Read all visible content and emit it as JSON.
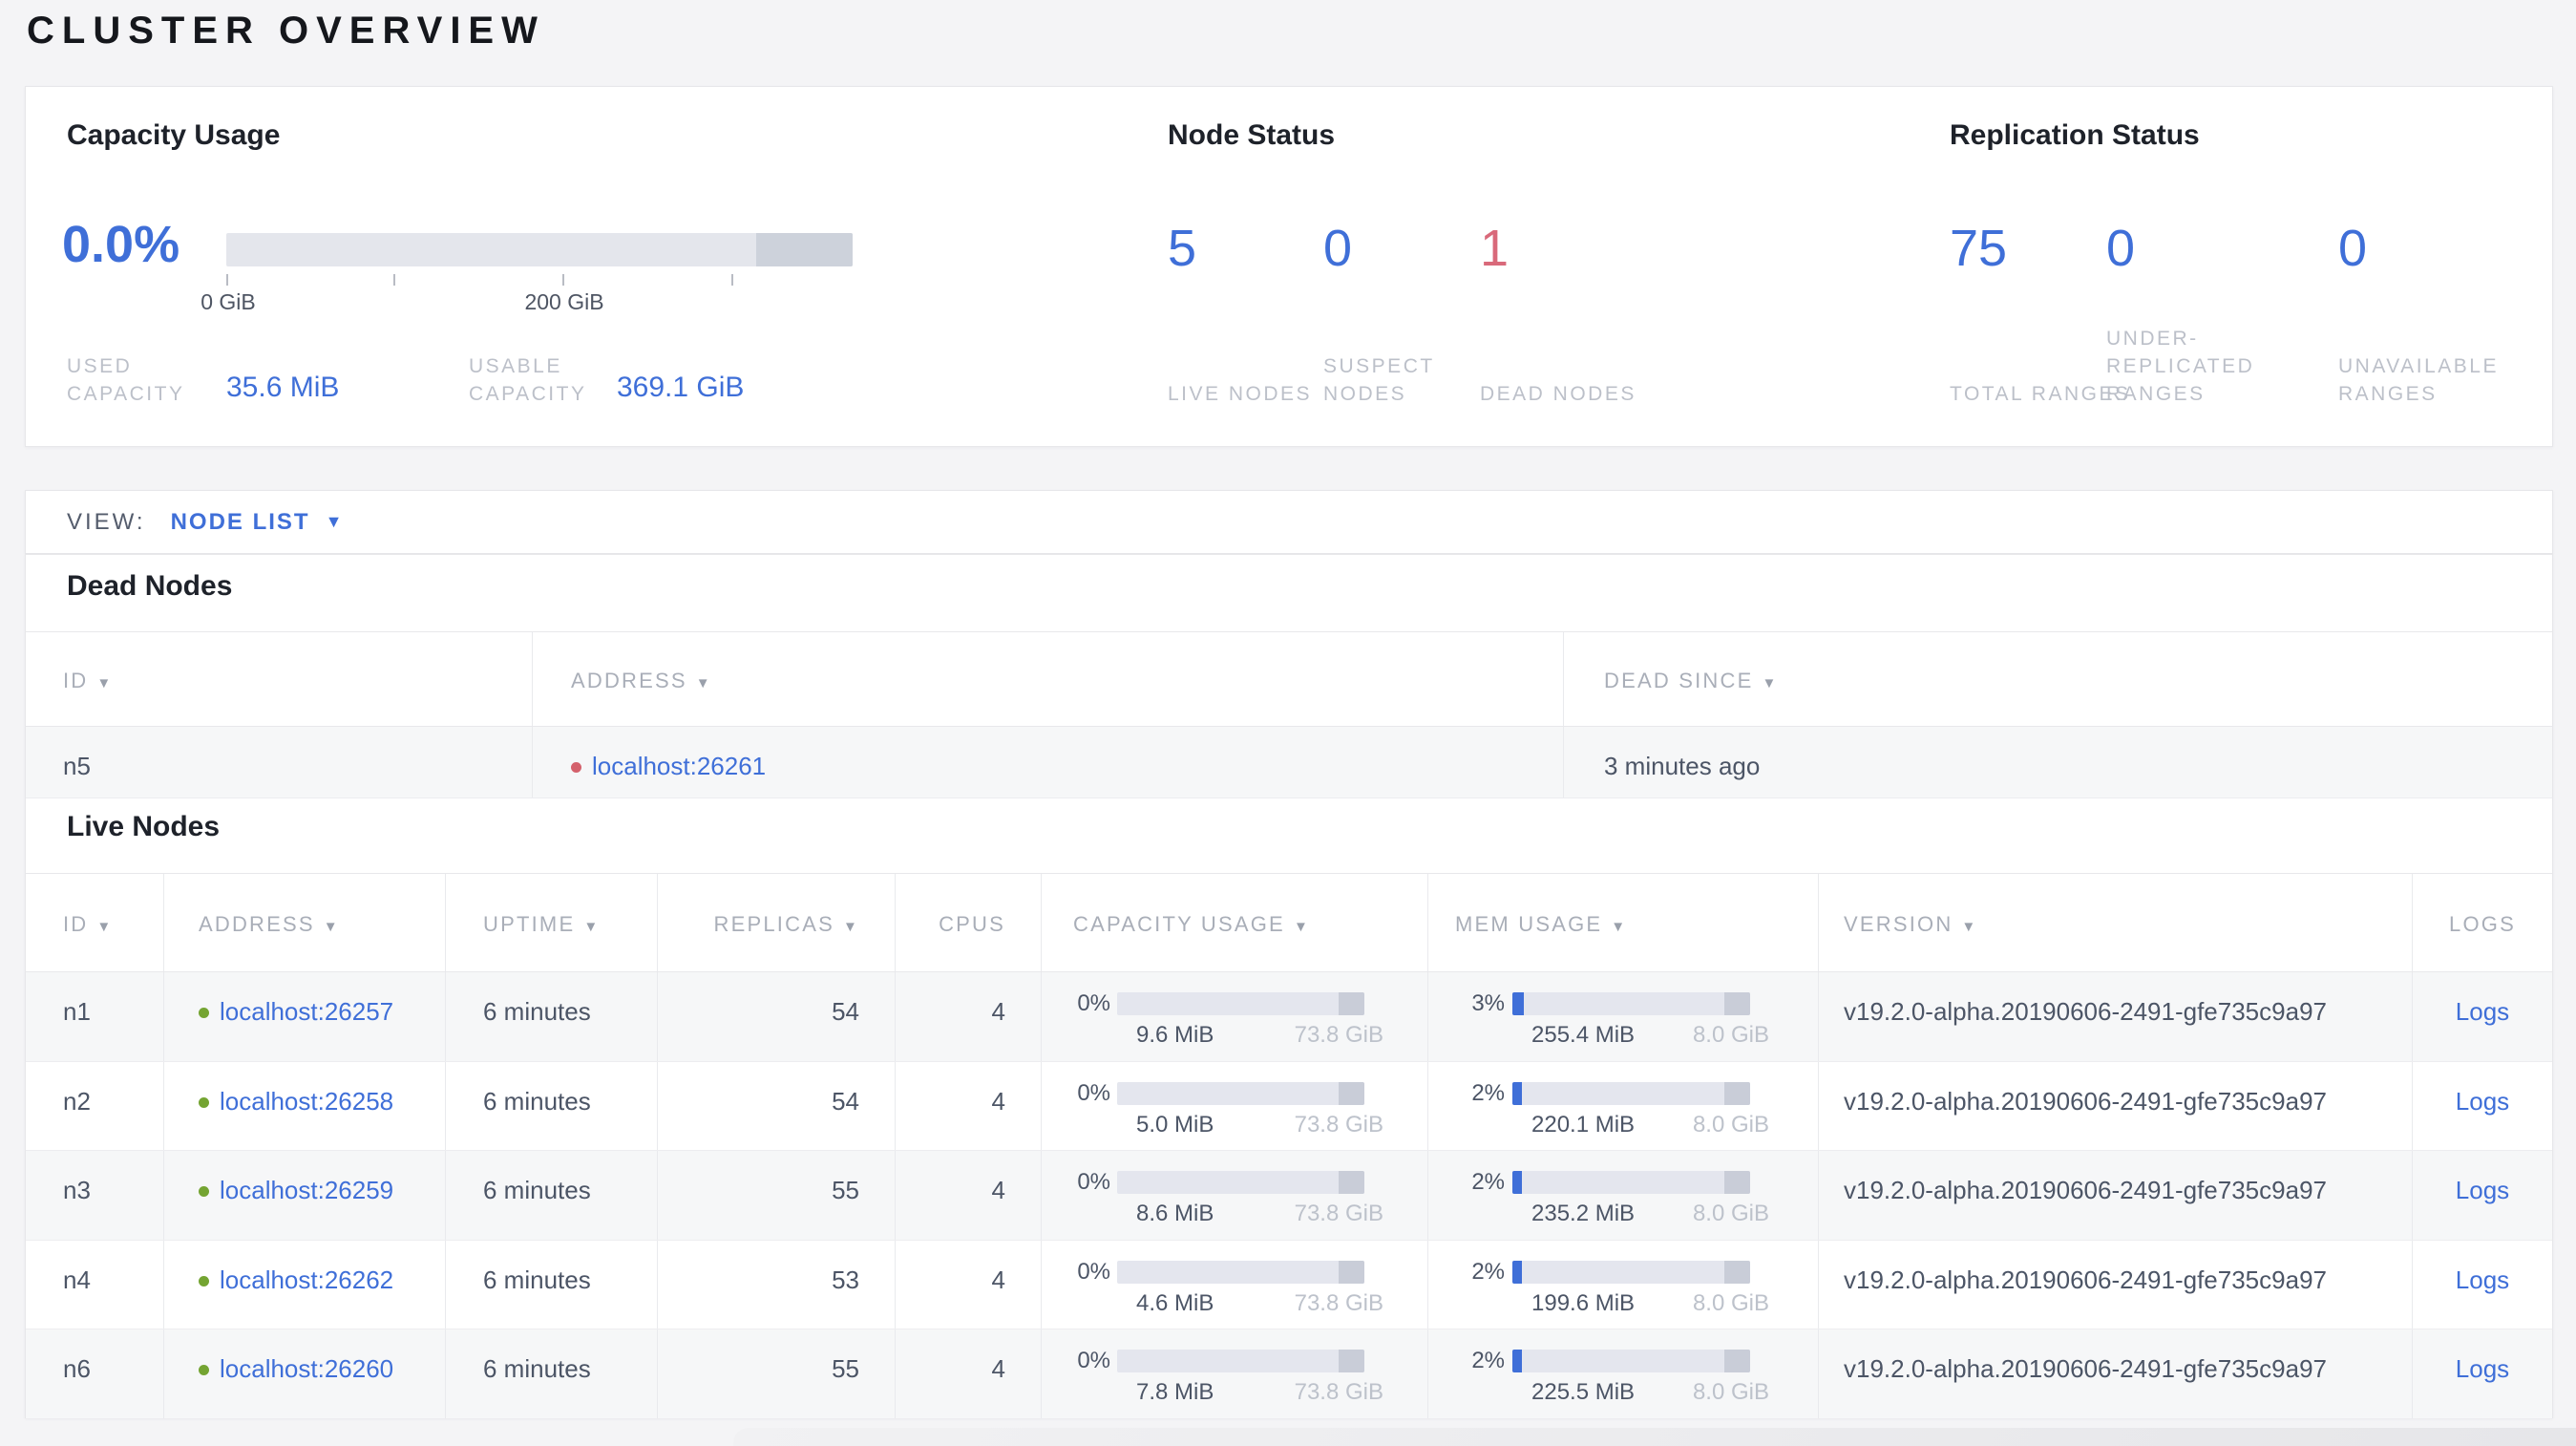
{
  "page": {
    "title": "CLUSTER OVERVIEW"
  },
  "colors": {
    "accent_blue": "#3f6fd8",
    "danger_red": "#d9697a",
    "live_dot_green": "#74a432",
    "dead_dot_red": "#d4616c",
    "bar_track": "#e4e6ec",
    "bar_reserved": "#cdd2db",
    "mem_fill_blue": "#3f6fd8"
  },
  "summary": {
    "capacity_usage": {
      "title": "Capacity Usage",
      "percent_label": "0.0%",
      "axis": {
        "tick_label_0": "0 GiB",
        "tick_label_200": "200 GiB"
      },
      "used": {
        "label": "USED CAPACITY",
        "value": "35.6 MiB"
      },
      "usable": {
        "label": "USABLE CAPACITY",
        "value": "369.1 GiB"
      }
    },
    "node_status": {
      "title": "Node Status",
      "stats": [
        {
          "value": "5",
          "label": "LIVE NODES",
          "tone": "blue"
        },
        {
          "value": "0",
          "label": "SUSPECT NODES",
          "tone": "blue"
        },
        {
          "value": "1",
          "label": "DEAD NODES",
          "tone": "red"
        }
      ]
    },
    "replication_status": {
      "title": "Replication Status",
      "stats": [
        {
          "value": "75",
          "label": "TOTAL RANGES",
          "tone": "blue"
        },
        {
          "value": "0",
          "label": "UNDER-REPLICATED RANGES",
          "tone": "blue"
        },
        {
          "value": "0",
          "label": "UNAVAILABLE RANGES",
          "tone": "blue"
        }
      ]
    }
  },
  "view_bar": {
    "label": "VIEW:",
    "selected": "NODE LIST"
  },
  "dead_nodes": {
    "heading": "Dead Nodes",
    "columns": [
      {
        "label": "ID",
        "sortable": true
      },
      {
        "label": "ADDRESS",
        "sortable": true
      },
      {
        "label": "DEAD SINCE",
        "sortable": true
      }
    ],
    "rows": [
      {
        "id": "n5",
        "address": "localhost:26261",
        "dead_since": "3 minutes ago"
      }
    ]
  },
  "live_nodes": {
    "heading": "Live Nodes",
    "columns": [
      {
        "label": "ID",
        "sortable": true
      },
      {
        "label": "ADDRESS",
        "sortable": true
      },
      {
        "label": "UPTIME",
        "sortable": true
      },
      {
        "label": "REPLICAS",
        "sortable": true
      },
      {
        "label": "CPUS",
        "sortable": false
      },
      {
        "label": "CAPACITY USAGE",
        "sortable": true
      },
      {
        "label": "MEM USAGE",
        "sortable": true
      },
      {
        "label": "VERSION",
        "sortable": true
      },
      {
        "label": "LOGS",
        "sortable": false
      }
    ],
    "rows": [
      {
        "id": "n1",
        "address": "localhost:26257",
        "uptime": "6 minutes",
        "replicas": "54",
        "cpus": "4",
        "capacity": {
          "pct": 0,
          "pct_label": "0%",
          "used": "9.6 MiB",
          "total": "73.8 GiB"
        },
        "memory": {
          "pct": 3,
          "pct_label": "3%",
          "used": "255.4 MiB",
          "total": "8.0 GiB"
        },
        "version": "v19.2.0-alpha.20190606-2491-gfe735c9a97",
        "logs": "Logs"
      },
      {
        "id": "n2",
        "address": "localhost:26258",
        "uptime": "6 minutes",
        "replicas": "54",
        "cpus": "4",
        "capacity": {
          "pct": 0,
          "pct_label": "0%",
          "used": "5.0 MiB",
          "total": "73.8 GiB"
        },
        "memory": {
          "pct": 2,
          "pct_label": "2%",
          "used": "220.1 MiB",
          "total": "8.0 GiB"
        },
        "version": "v19.2.0-alpha.20190606-2491-gfe735c9a97",
        "logs": "Logs"
      },
      {
        "id": "n3",
        "address": "localhost:26259",
        "uptime": "6 minutes",
        "replicas": "55",
        "cpus": "4",
        "capacity": {
          "pct": 0,
          "pct_label": "0%",
          "used": "8.6 MiB",
          "total": "73.8 GiB"
        },
        "memory": {
          "pct": 2,
          "pct_label": "2%",
          "used": "235.2 MiB",
          "total": "8.0 GiB"
        },
        "version": "v19.2.0-alpha.20190606-2491-gfe735c9a97",
        "logs": "Logs"
      },
      {
        "id": "n4",
        "address": "localhost:26262",
        "uptime": "6 minutes",
        "replicas": "53",
        "cpus": "4",
        "capacity": {
          "pct": 0,
          "pct_label": "0%",
          "used": "4.6 MiB",
          "total": "73.8 GiB"
        },
        "memory": {
          "pct": 2,
          "pct_label": "2%",
          "used": "199.6 MiB",
          "total": "8.0 GiB"
        },
        "version": "v19.2.0-alpha.20190606-2491-gfe735c9a97",
        "logs": "Logs"
      },
      {
        "id": "n6",
        "address": "localhost:26260",
        "uptime": "6 minutes",
        "replicas": "55",
        "cpus": "4",
        "capacity": {
          "pct": 0,
          "pct_label": "0%",
          "used": "7.8 MiB",
          "total": "73.8 GiB"
        },
        "memory": {
          "pct": 2,
          "pct_label": "2%",
          "used": "225.5 MiB",
          "total": "8.0 GiB"
        },
        "version": "v19.2.0-alpha.20190606-2491-gfe735c9a97",
        "logs": "Logs"
      }
    ]
  }
}
